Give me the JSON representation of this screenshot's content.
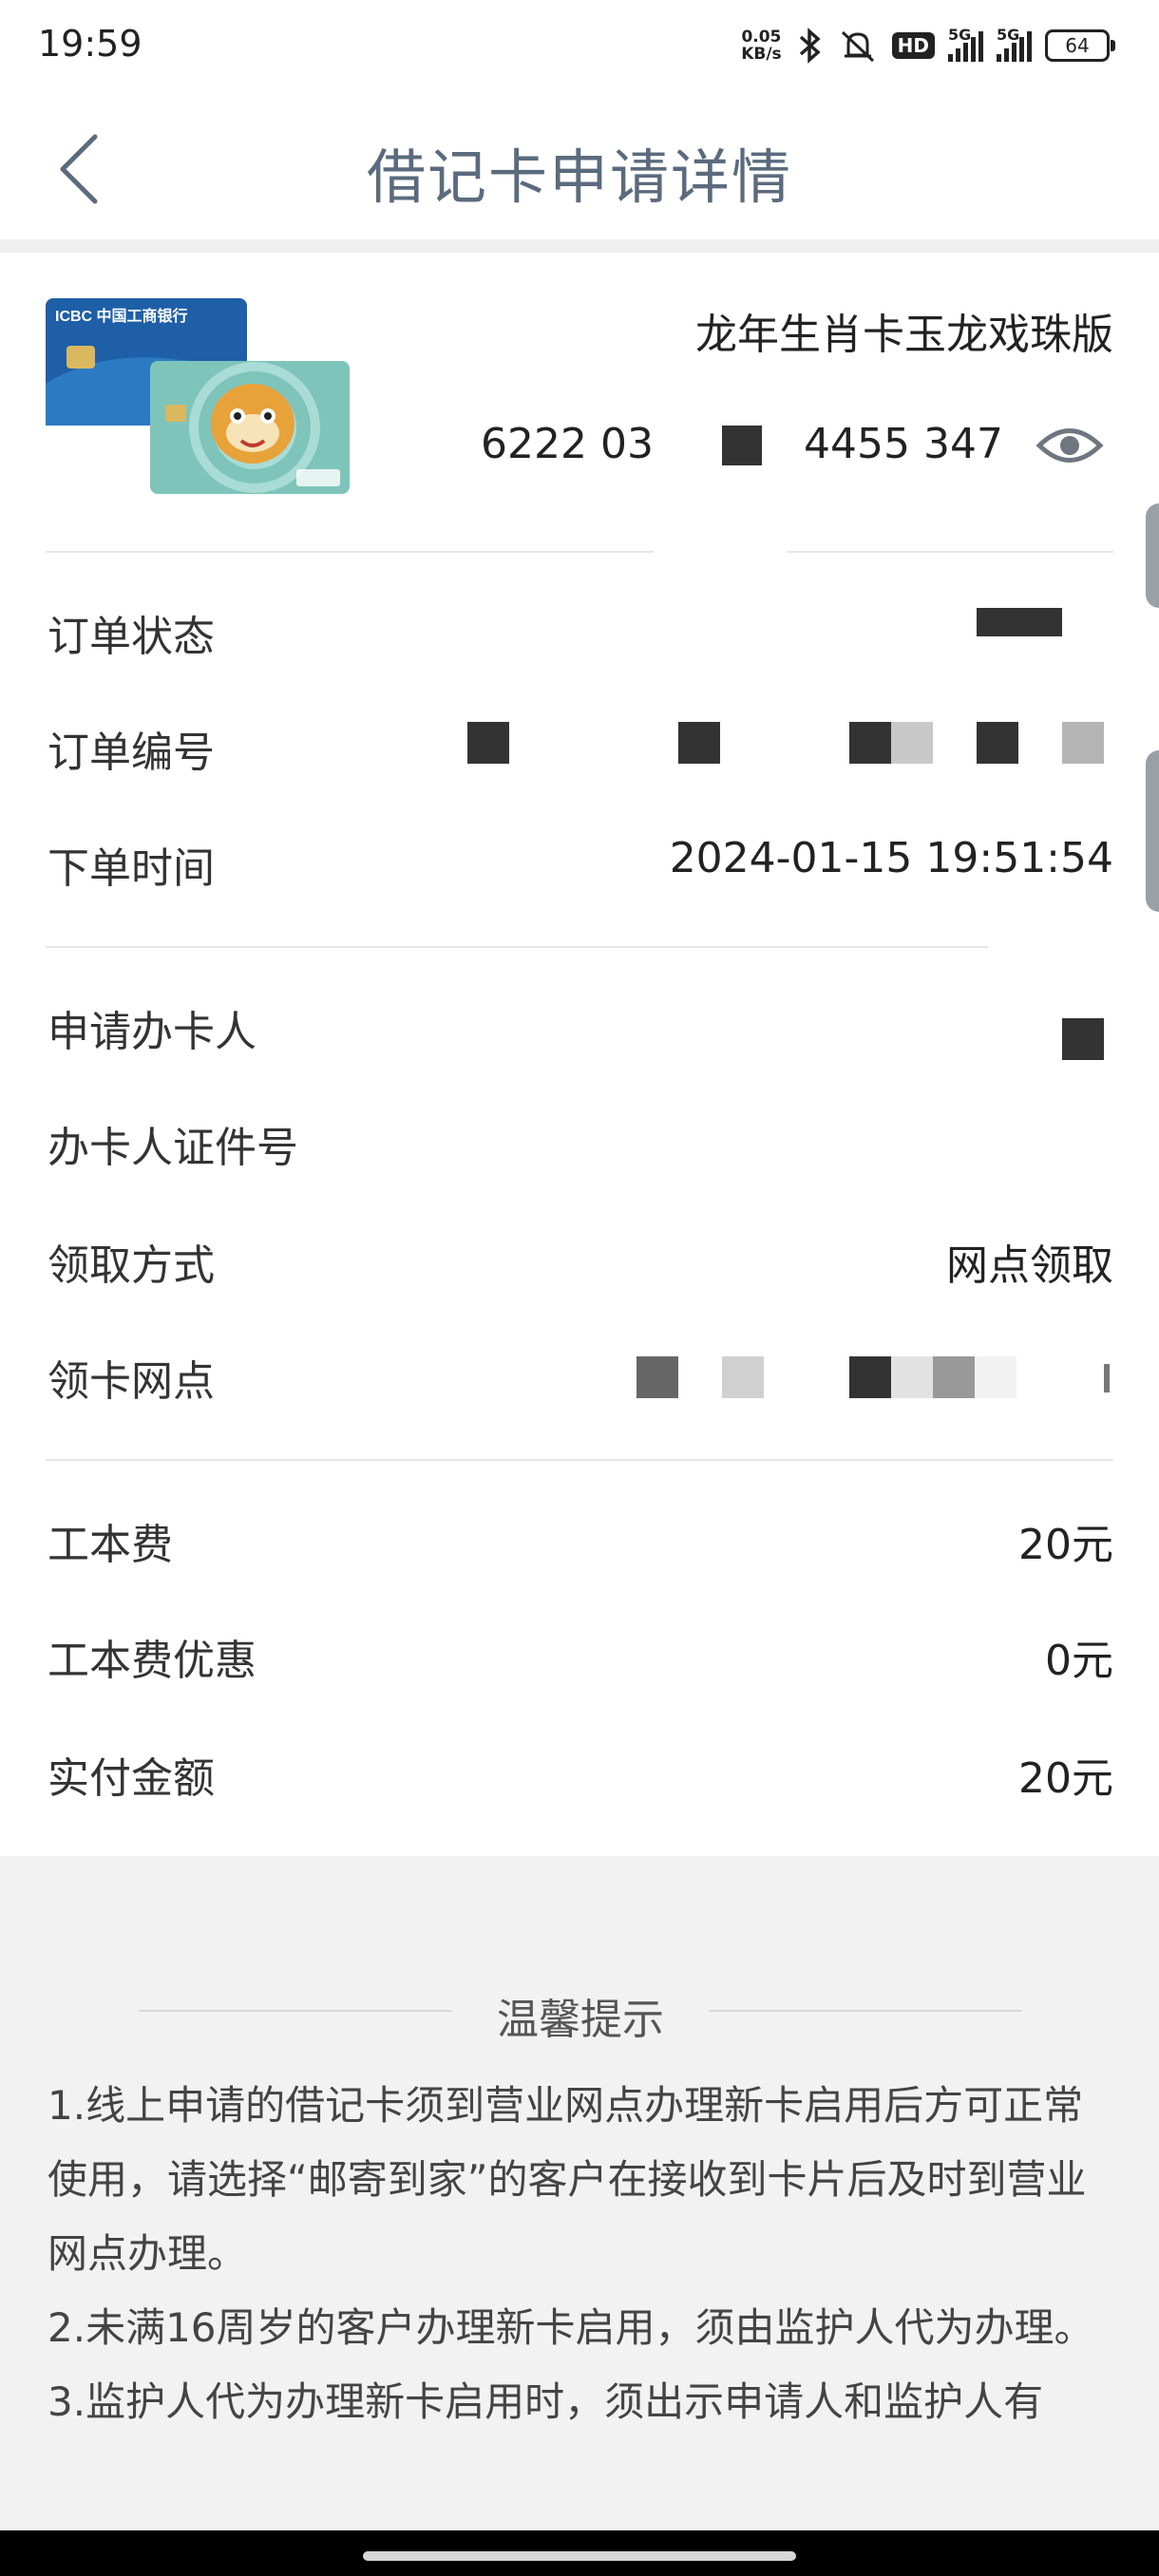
{
  "status_bar": {
    "time": "19:59",
    "net_speed_value": "0.05",
    "net_speed_unit": "KB/s",
    "hd_label": "HD",
    "signal_1": "5G",
    "signal_2": "5G",
    "battery": "64"
  },
  "header": {
    "title": "借记卡申请详情",
    "back_icon": "chevron-left-icon"
  },
  "card": {
    "name": "龙年生肖卡玉龙戏珠版",
    "number_part1": "6222 03",
    "number_part3": "4455 347",
    "bank_logo": "ICBC 中国工商银行",
    "eye_icon": "eye-icon"
  },
  "order": {
    "status_label": "订单状态",
    "number_label": "订单编号",
    "time_label": "下单时间",
    "time_value": "2024-01-15 19:51:54"
  },
  "applicant": {
    "name_label": "申请办卡人",
    "id_label": "办卡人证件号",
    "method_label": "领取方式",
    "method_value": "网点领取",
    "branch_label": "领卡网点"
  },
  "fees": {
    "cost_label": "工本费",
    "cost_value": "20元",
    "discount_label": "工本费优惠",
    "discount_value": "0元",
    "paid_label": "实付金额",
    "paid_value": "20元"
  },
  "tips": {
    "title": "温馨提示",
    "line1": "1.线上申请的借记卡须到营业网点办理新卡启用后方可正常使用，请选择“邮寄到家”的客户在接收到卡片后及时到营业网点办理。",
    "line2": "2.未满16周岁的客户办理新卡启用，须由监护人代为办理。",
    "line3": "3.监护人代为办理新卡启用时，须出示申请人和监护人有"
  },
  "colors": {
    "title": "#5b6b7d",
    "text": "#333333",
    "mask": "#333333",
    "tips_bg": "#f2f2f2"
  }
}
